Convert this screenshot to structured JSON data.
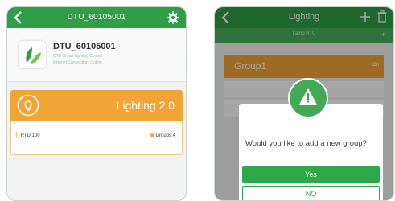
{
  "left_screen": {
    "header": {
      "title": "DTU_60105001",
      "back_icon": "back-arrow-icon",
      "settings_icon": "gear-icon"
    },
    "device": {
      "name": "DTU_60105001",
      "line1": "DTU Smart Lighting Control",
      "line2": "Internet Connection: Online",
      "logo_icon": "leaf-icon"
    },
    "banner": {
      "title": "Lighting 2.0",
      "icon": "bulb-icon"
    },
    "stats": {
      "rtu": "RTU:100",
      "groups": "Groups:4"
    }
  },
  "right_screen": {
    "header": {
      "title": "Lighting",
      "back_icon": "back-arrow-icon",
      "add_icon": "plus-icon",
      "delete_icon": "trash-icon"
    },
    "subbar": {
      "text": "Lamp RTU",
      "add": "+"
    },
    "group": {
      "title": "Group1",
      "meta": "On"
    },
    "dialog": {
      "icon": "warning-icon",
      "message": "Would you like to add a new group?",
      "yes_label": "Yes",
      "no_label": "NO"
    }
  },
  "colors": {
    "primary_green": "#2f9e46",
    "accent_orange": "#f1a536"
  }
}
